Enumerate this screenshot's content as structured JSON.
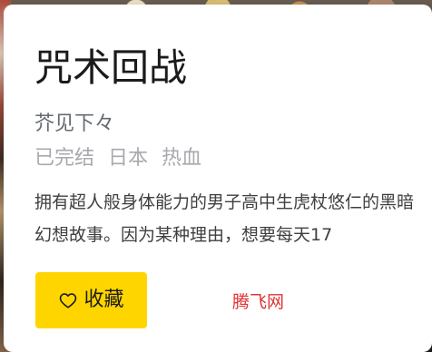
{
  "title": "咒术回战",
  "author": "芥见下々",
  "tags": [
    "已完结",
    "日本",
    "热血"
  ],
  "description": "拥有超人般身体能力的男子高中生虎杖悠仁的黑暗幻想故事。因为某种理由，想要每天17",
  "actions": {
    "favorite_label": "收藏",
    "favorite_icon": "heart-outline-icon"
  },
  "source": "腾飞网",
  "colors": {
    "favorite_button": "#ffd500",
    "source_text": "#e03131"
  }
}
